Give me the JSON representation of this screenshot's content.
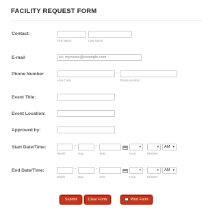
{
  "form": {
    "title": "FACILITY REQUEST FORM",
    "contact": {
      "label": "Contact:",
      "first_name_sub": "First Name",
      "last_name_sub": "Last Name",
      "first_value": "",
      "last_value": ""
    },
    "email": {
      "label": "E-mail",
      "placeholder": "ex: myname@example.com",
      "value": ""
    },
    "phone": {
      "label": "Phone Number",
      "area_code_sub": "Area Code",
      "number_sub": "Phone Number",
      "separator": "-"
    },
    "event_title": {
      "label": "Event Title:"
    },
    "event_location": {
      "label": "Event Location:"
    },
    "approved_by": {
      "label": "Approved by:"
    },
    "start": {
      "label": "Start Date/Time:",
      "month_sub": "Month",
      "day_sub": "Day",
      "year_sub": "Year",
      "hour_sub": "Hour",
      "minutes_sub": "Minutes",
      "ampm_value": "AM",
      "date_sep": "-",
      "time_sep": ":"
    },
    "end": {
      "label": "End Date/Time:",
      "month_sub": "Month",
      "day_sub": "Day",
      "year_sub": "Year",
      "hour_sub": "Hour",
      "minutes_sub": "Minutes",
      "ampm_value": "AM",
      "date_sep": "-",
      "time_sep": ":"
    },
    "buttons": {
      "submit": "Submit",
      "clear": "Clear Form",
      "print": "Print Form"
    },
    "icons": {
      "dropdown": "chevron-down-icon",
      "calendar": "calendar-icon",
      "print": "printer-icon"
    },
    "colors": {
      "button_bg": "#c9321c",
      "button_border": "#7d1a0c"
    }
  }
}
